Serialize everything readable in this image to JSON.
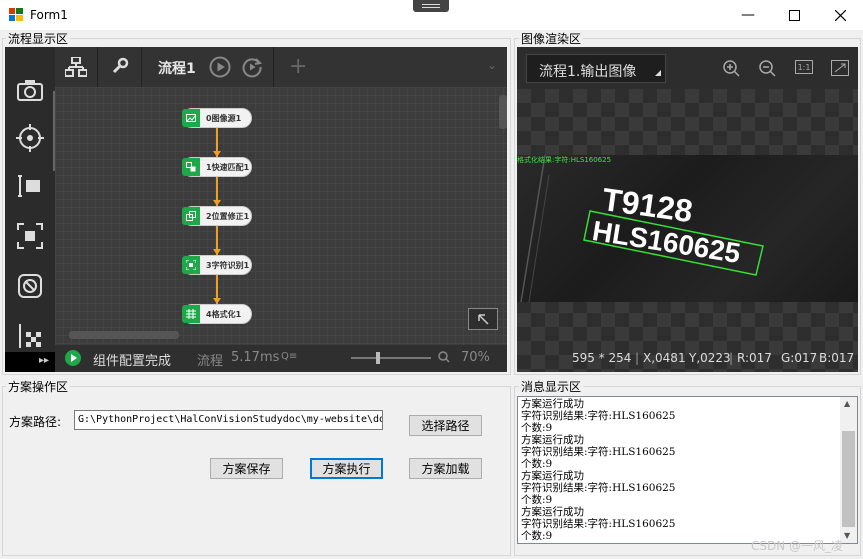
{
  "window": {
    "title": "Form1"
  },
  "flow_panel": {
    "label": "流程显示区",
    "tab_label": "流程1",
    "nodes": [
      "0图像源1",
      "1快速匹配1",
      "2位置修正1",
      "3字符识别1",
      "4格式化1"
    ],
    "status": {
      "message": "组件配置完成",
      "flow_label": "流程",
      "time": "5.17ms",
      "zoom": "70%"
    }
  },
  "image_panel": {
    "label": "图像渲染区",
    "selected_image": "流程1.输出图像",
    "overlay_text": "格式化结果:字符:HLS160625",
    "plate_line1": "T9128",
    "plate_line2": "HLS160625",
    "info": {
      "size": "595 * 254",
      "x": "X,0481",
      "y": "Y,0223",
      "r": "R:017",
      "g": "G:017",
      "b": "B:017"
    },
    "zoom_fit_label": "1:1"
  },
  "scheme_panel": {
    "label": "方案操作区",
    "path_label": "方案路径:",
    "path_value": "G:\\PythonProject\\HalConVisionStudydoc\\my-website\\do",
    "select_path_button": "选择路径",
    "save_button": "方案保存",
    "run_button": "方案执行",
    "load_button": "方案加载"
  },
  "message_panel": {
    "label": "消息显示区",
    "lines": [
      "方案运行成功",
      "字符识别结果:字符:HLS160625",
      "个数:9",
      "方案运行成功",
      "字符识别结果:字符:HLS160625",
      "个数:9",
      "方案运行成功",
      "字符识别结果:字符:HLS160625",
      "个数:9",
      "方案运行成功",
      "字符识别结果:字符:HLS160625",
      "个数:9"
    ]
  },
  "watermark": "CSDN @一风_凌"
}
